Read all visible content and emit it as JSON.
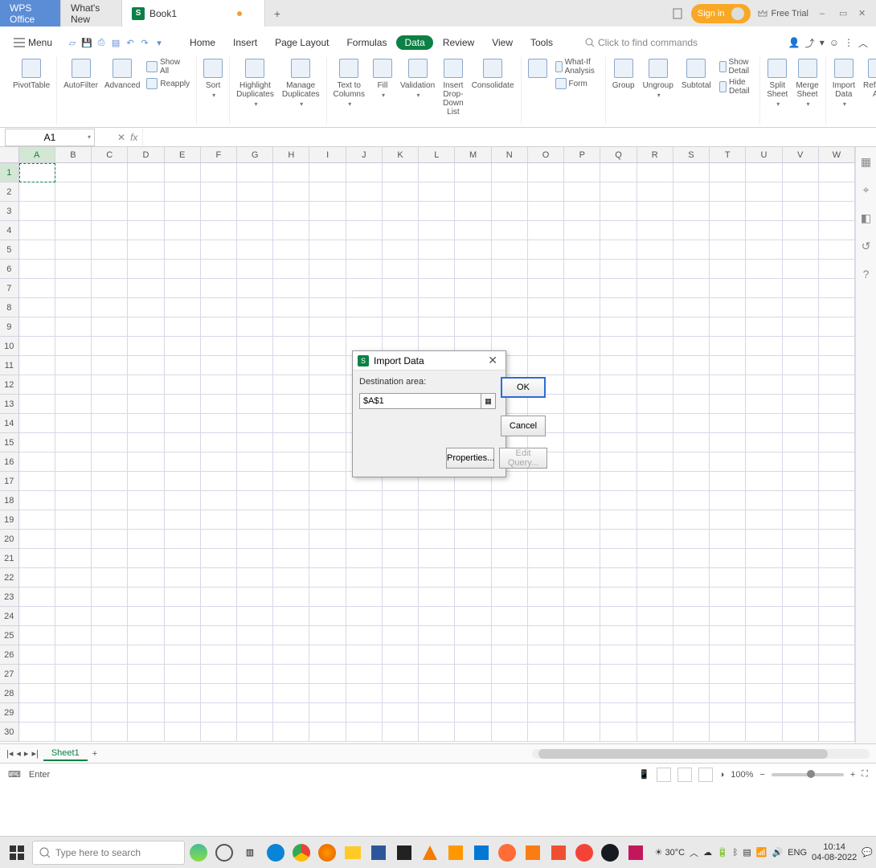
{
  "titlebar": {
    "app": "WPS Office",
    "whats_new": "What's New",
    "doc": "Book1",
    "new_tab": "+",
    "device_icon": "device",
    "signin": "Sign in",
    "free_trial": "Free Trial",
    "min": "–",
    "max": "▭",
    "close": "✕"
  },
  "menu_label": "Menu",
  "ribbon_tabs": [
    "Home",
    "Insert",
    "Page Layout",
    "Formulas",
    "Data",
    "Review",
    "View",
    "Tools"
  ],
  "active_tab": "Data",
  "search_placeholder": "Click to find commands",
  "ribbon": {
    "pivottable": "PivotTable",
    "autofilter": "AutoFilter",
    "advanced": "Advanced",
    "show_all": "Show All",
    "reapply": "Reapply",
    "sort": "Sort",
    "highlight": "Highlight Duplicates",
    "manage_dup": "Manage Duplicates",
    "text_to_cols": "Text to Columns",
    "fill": "Fill",
    "validation": "Validation",
    "insert_dropdown": "Insert Drop-Down List",
    "consolidate": "Consolidate",
    "whatif": "What-If Analysis",
    "form": "Form",
    "group": "Group",
    "ungroup": "Ungroup",
    "subtotal": "Subtotal",
    "show_detail": "Show Detail",
    "hide_detail": "Hide Detail",
    "split_sheet": "Split Sheet",
    "merge_sheet": "Merge Sheet",
    "import_data": "Import Data",
    "refresh_all": "Refresh All"
  },
  "namebox": "A1",
  "columns": [
    "A",
    "B",
    "C",
    "D",
    "E",
    "F",
    "G",
    "H",
    "I",
    "J",
    "K",
    "L",
    "M",
    "N",
    "O",
    "P",
    "Q",
    "R",
    "S",
    "T",
    "U",
    "V",
    "W"
  ],
  "rows": [
    "1",
    "2",
    "3",
    "4",
    "5",
    "6",
    "7",
    "8",
    "9",
    "10",
    "11",
    "12",
    "13",
    "14",
    "15",
    "16",
    "17",
    "18",
    "19",
    "20",
    "21",
    "22",
    "23",
    "24",
    "25",
    "26",
    "27",
    "28",
    "29",
    "30"
  ],
  "sheet_tab": "Sheet1",
  "status_mode": "Enter",
  "zoom": "100%",
  "dialog": {
    "title": "Import Data",
    "dest_label": "Destination area:",
    "dest_value": "$A$1",
    "ok": "OK",
    "cancel": "Cancel",
    "properties": "Properties...",
    "edit_query": "Edit Query..."
  },
  "taskbar": {
    "search": "Type here to search",
    "weather": "30°C",
    "lang": "ENG",
    "time": "10:14",
    "date": "04-08-2022"
  }
}
